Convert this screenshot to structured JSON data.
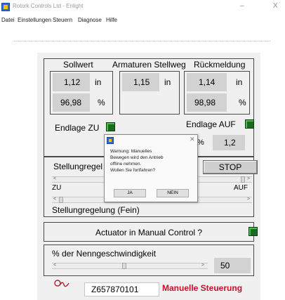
{
  "window": {
    "title": "Rotork Controls Ltd - Enlight",
    "minimize_glyph": "–",
    "close_glyph": "X"
  },
  "menu": [
    {
      "label": "Datei"
    },
    {
      "label": "Einstellungen"
    },
    {
      "label": "Steuern"
    },
    {
      "label": "Diagnose"
    },
    {
      "label": "Hilfe"
    }
  ],
  "headers": {
    "sollwert": "Sollwert",
    "stellweg": "Armaturen Stellweg",
    "rueckmeldung": "Rückmeldung"
  },
  "sollwert": {
    "value_in": "1,12",
    "unit_in": "in",
    "value_pct": "96,98",
    "unit_pct": "%"
  },
  "stellweg": {
    "value_in": "1,15",
    "unit_in": "in"
  },
  "rueckmeldung": {
    "value_in": "1,14",
    "unit_in": "in",
    "value_pct": "98,98",
    "unit_pct": "%"
  },
  "endlage": {
    "zu_label": "Endlage ZU",
    "auf_label": "Endlage AUF",
    "partial_unit": "%",
    "auf_value": "1,2"
  },
  "stellung": {
    "label": "Stellungregel",
    "stop_label": "STOP",
    "zu": "ZU",
    "auf": "AUF",
    "fein_label": "Stellungregelung (Fein)"
  },
  "manual": {
    "label": "Actuator in Manual Control ?"
  },
  "speed": {
    "label": "% der Nenngeschwindigkeit",
    "value": "50"
  },
  "footer": {
    "serial": "Z657870101",
    "mode": "Manuelle Steuerung"
  },
  "dialog": {
    "close_glyph": "✕",
    "lines": [
      "Warnung: Manuelles",
      "Bewegen wird den Antrieb",
      "offline nehmen.",
      "Wollen Sie fortfahren?"
    ],
    "yes_label": "JA",
    "no_label": "NEIN"
  },
  "colors": {
    "led_green": "#1c6b22",
    "mode_red": "#c8102e",
    "panel_bg": "#f0f0f0",
    "field_bg": "#d2d2d2"
  }
}
